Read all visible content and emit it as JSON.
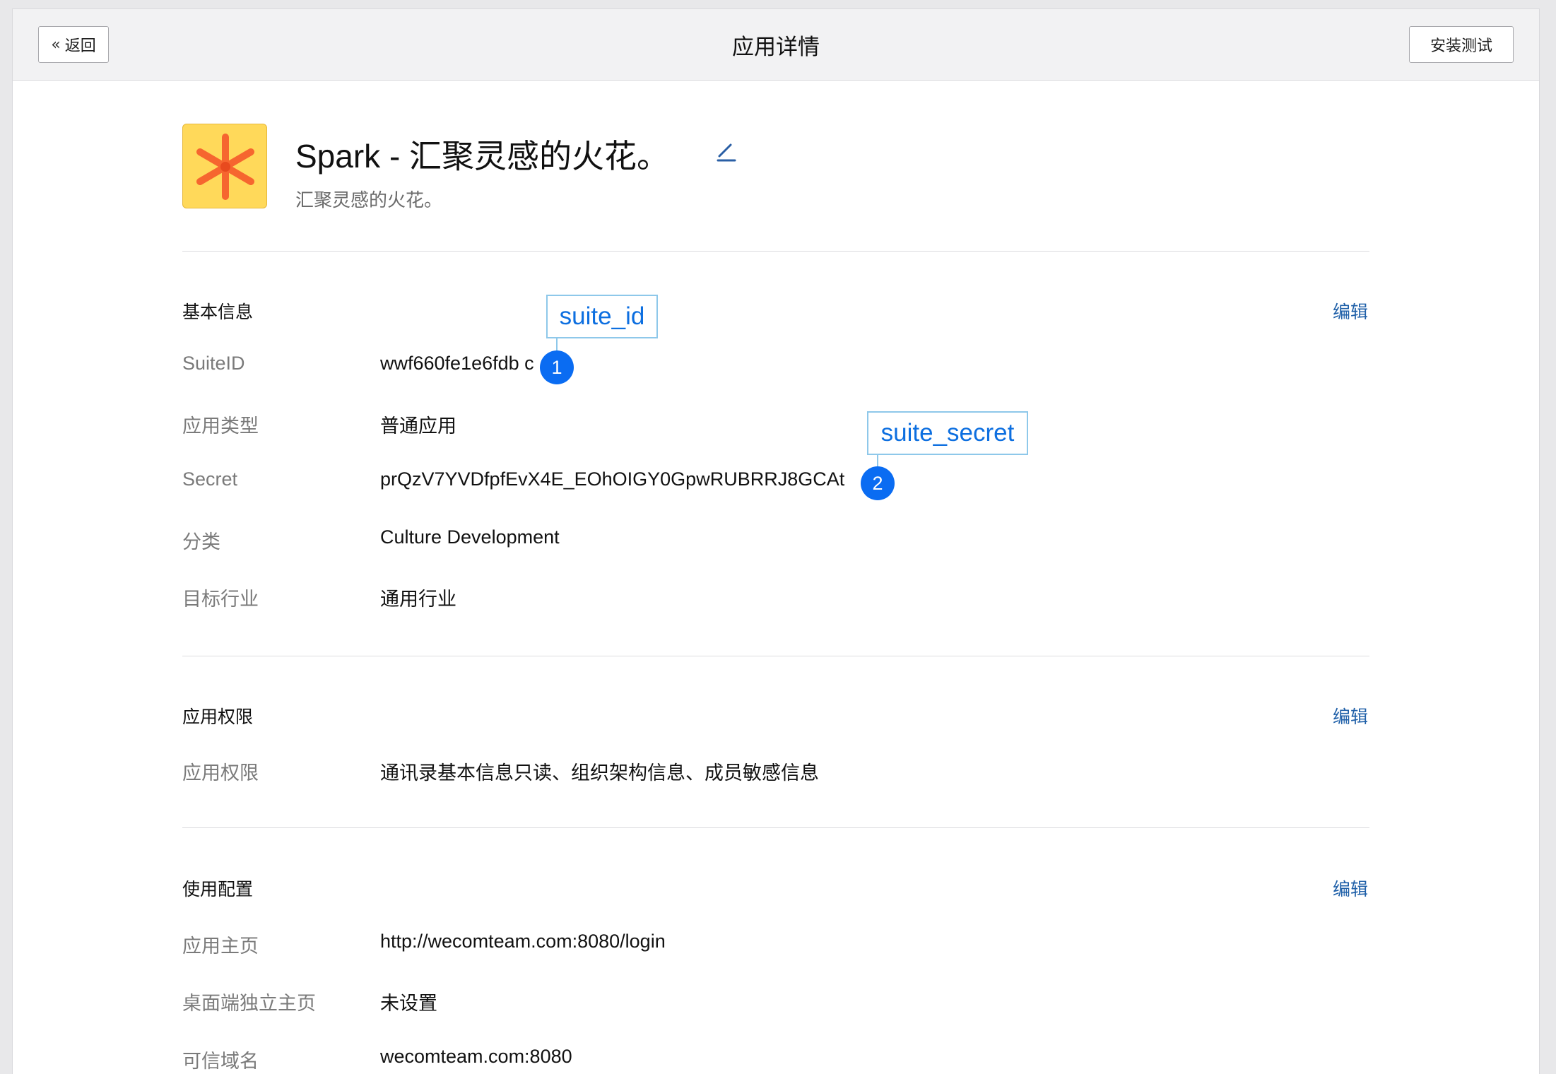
{
  "topbar": {
    "back_label": "返回",
    "title": "应用详情",
    "install_label": "安装测试"
  },
  "app": {
    "name": "Spark - 汇聚灵感的火花。",
    "description": "汇聚灵感的火花。",
    "icon": "asterisk-app-icon",
    "icon_colors": {
      "background": "#ffd95a",
      "glyph": "#f6602d"
    }
  },
  "sections": {
    "basic": {
      "title": "基本信息",
      "edit_label": "编辑",
      "rows": [
        {
          "label": "SuiteID",
          "value": "wwf660fe1e6fdb c"
        },
        {
          "label": "应用类型",
          "value": "普通应用"
        },
        {
          "label": "Secret",
          "value": "prQzV7YVDfpfEvX4E_EOhOIGY0GpwRUBRRJ8GCAt"
        },
        {
          "label": "分类",
          "value": "Culture Development"
        },
        {
          "label": "目标行业",
          "value": "通用行业"
        }
      ]
    },
    "permissions": {
      "title": "应用权限",
      "edit_label": "编辑",
      "rows": [
        {
          "label": "应用权限",
          "value": "通讯录基本信息只读、组织架构信息、成员敏感信息"
        }
      ]
    },
    "config": {
      "title": "使用配置",
      "edit_label": "编辑",
      "rows": [
        {
          "label": "应用主页",
          "value": "http://wecomteam.com:8080/login"
        },
        {
          "label": "桌面端独立主页",
          "value": "未设置"
        },
        {
          "label": "可信域名",
          "value": "wecomteam.com:8080"
        }
      ]
    }
  },
  "annotations": [
    {
      "badge": "1",
      "label": "suite_id"
    },
    {
      "badge": "2",
      "label": "suite_secret"
    }
  ],
  "colors": {
    "link": "#1e5fa8",
    "annotation_text": "#0d6fe0",
    "annotation_badge": "#0a6cf2",
    "annotation_border": "#8ec8ea"
  }
}
